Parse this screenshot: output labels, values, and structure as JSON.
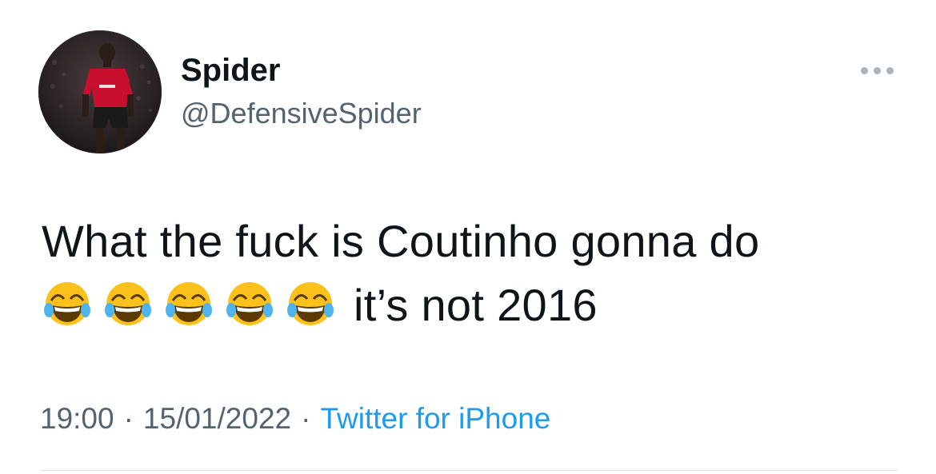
{
  "author": {
    "display_name": "Spider",
    "handle": "@DefensiveSpider",
    "avatar_icon": "profile-photo-footballer-red-kit"
  },
  "more_icon": "more-horizontal-icon",
  "tweet": {
    "text_line1": "What the fuck is Coutinho gonna do",
    "emoji": [
      "😂",
      "😂",
      "😂",
      "😂",
      "😂"
    ],
    "emoji_icon": "face-with-tears-of-joy-icon",
    "text_line2": "it’s not 2016"
  },
  "meta": {
    "time": "19:00",
    "separator": "·",
    "date": "15/01/2022",
    "source": "Twitter for iPhone"
  },
  "colors": {
    "text": "#0f1419",
    "secondary": "#536471",
    "link": "#1d9bf0",
    "divider": "#dfe4e8"
  }
}
